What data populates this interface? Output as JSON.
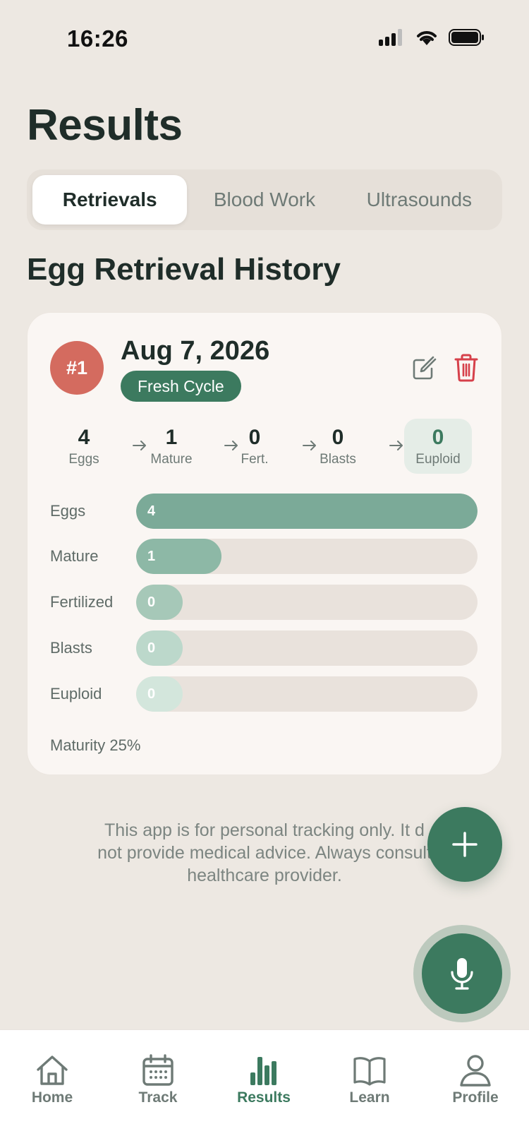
{
  "status": {
    "time": "16:26"
  },
  "page": {
    "title": "Results"
  },
  "tabs": [
    {
      "label": "Retrievals",
      "active": true
    },
    {
      "label": "Blood Work",
      "active": false
    },
    {
      "label": "Ultrasounds",
      "active": false
    }
  ],
  "section": {
    "title": "Egg Retrieval History"
  },
  "retrieval": {
    "number": "#1",
    "date": "Aug 7, 2026",
    "cycle_type": "Fresh Cycle",
    "funnel": [
      {
        "value": "4",
        "label": "Eggs"
      },
      {
        "value": "1",
        "label": "Mature"
      },
      {
        "value": "0",
        "label": "Fert."
      },
      {
        "value": "0",
        "label": "Blasts"
      },
      {
        "value": "0",
        "label": "Euploid"
      }
    ],
    "bars": [
      {
        "label": "Eggs",
        "value": "4",
        "fraction": 1.0,
        "color": "#7BAA98"
      },
      {
        "label": "Mature",
        "value": "1",
        "fraction": 0.25,
        "color": "#8DB8A6"
      },
      {
        "label": "Fertilized",
        "value": "0",
        "fraction": 0,
        "color": "#A6C8B8"
      },
      {
        "label": "Blasts",
        "value": "0",
        "fraction": 0,
        "color": "#BCD8CB"
      },
      {
        "label": "Euploid",
        "value": "0",
        "fraction": 0,
        "color": "#D3E6DC"
      }
    ],
    "maturity": "Maturity 25%"
  },
  "disclaimer": {
    "line1": "This app is for personal tracking only. It d",
    "line2": "not provide medical advice. Always consult",
    "line3": "healthcare provider."
  },
  "nav": [
    {
      "label": "Home",
      "icon": "home-icon",
      "active": false
    },
    {
      "label": "Track",
      "icon": "calendar-icon",
      "active": false
    },
    {
      "label": "Results",
      "icon": "bar-chart-icon",
      "active": true
    },
    {
      "label": "Learn",
      "icon": "book-icon",
      "active": false
    },
    {
      "label": "Profile",
      "icon": "person-icon",
      "active": false
    }
  ],
  "colors": {
    "accent": "#3C7A5F",
    "badge": "#D46B5F",
    "delete": "#D6404A",
    "background": "#EDE8E2"
  }
}
